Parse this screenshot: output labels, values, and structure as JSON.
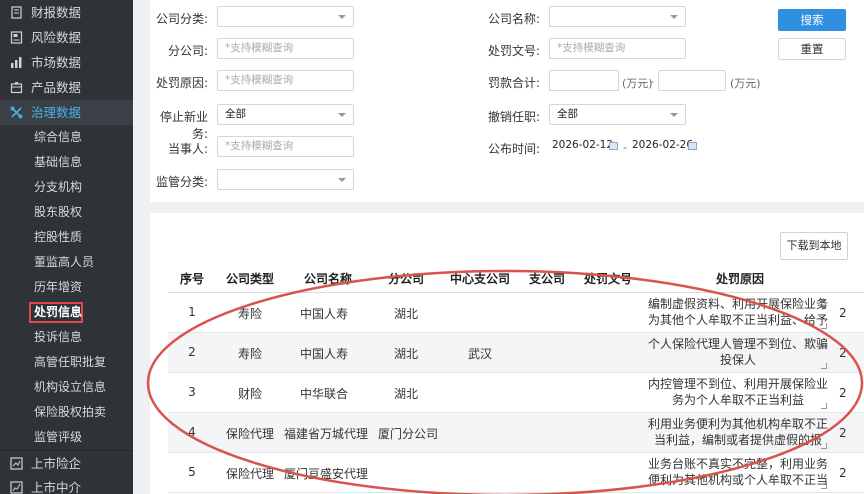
{
  "sidebar": {
    "top_items": [
      {
        "label": "财报数据",
        "icon": "file-icon"
      },
      {
        "label": "风险数据",
        "icon": "document-icon"
      },
      {
        "label": "市场数据",
        "icon": "bar-chart-icon"
      },
      {
        "label": "产品数据",
        "icon": "box-icon"
      }
    ],
    "active_item": {
      "label": "治理数据",
      "icon": "governance-icon"
    },
    "sub_items": [
      "综合信息",
      "基础信息",
      "分支机构",
      "股东股权",
      "控股性质",
      "董监高人员",
      "历年增资",
      "处罚信息",
      "投诉信息",
      "高管任职批复",
      "机构设立信息",
      "保险股权拍卖",
      "监管评级"
    ],
    "current_sub_index": 7,
    "bottom_items": [
      {
        "label": "上市险企",
        "icon": "chart-icon"
      },
      {
        "label": "上市中介",
        "icon": "trend-icon"
      }
    ]
  },
  "filters": {
    "company_category_label": "公司分类:",
    "company_name_label": "公司名称:",
    "branch_label": "分公司:",
    "branch_placeholder": "*支持模糊查询",
    "penalty_doc_label": "处罚文号:",
    "penalty_doc_placeholder": "*支持模糊查询",
    "penalty_reason_label": "处罚原因:",
    "penalty_reason_placeholder": "*支持模糊查询",
    "fine_total_label": "罚款合计:",
    "fine_unit": "(万元)",
    "fine_sep": "-",
    "stop_business_label": "停止新业务:",
    "stop_business_value": "全部",
    "revoke_label": "撤销任职:",
    "revoke_value": "全部",
    "party_label": "当事人:",
    "party_placeholder": "*支持模糊查询",
    "publish_time_label": "公布时间:",
    "date_from": "2026-02-12",
    "date_sep": "-",
    "date_to": "2026-02-26",
    "supervision_label": "监管分类:",
    "search_button": "搜索",
    "reset_button": "重置"
  },
  "download_button": "下载到本地",
  "table": {
    "headers": [
      "序号",
      "公司类型",
      "公司名称",
      "分公司",
      "中心支公司",
      "支公司",
      "处罚文号",
      "处罚原因"
    ],
    "rows": [
      {
        "no": "1",
        "type": "寿险",
        "name": "中国人寿",
        "branch": "湖北",
        "center": "",
        "sub": "",
        "doc": "",
        "reason": "编制虚假资料、利用开展保险业务为其他个人牟取不正当利益、给予",
        "trunc": "2"
      },
      {
        "no": "2",
        "type": "寿险",
        "name": "中国人寿",
        "branch": "湖北",
        "center": "武汉",
        "sub": "",
        "doc": "",
        "reason": "个人保险代理人管理不到位、欺骗投保人",
        "trunc": "2"
      },
      {
        "no": "3",
        "type": "财险",
        "name": "中华联合",
        "branch": "湖北",
        "center": "",
        "sub": "",
        "doc": "",
        "reason": "内控管理不到位、利用开展保险业务为个人牟取不正当利益",
        "trunc": "2"
      },
      {
        "no": "4",
        "type": "保险代理",
        "name": "福建省万城代理",
        "branch": "厦门分公司",
        "center": "",
        "sub": "",
        "doc": "",
        "reason": "利用业务便利为其他机构牟取不正当利益，编制或者提供虚假的报",
        "trunc": "2"
      },
      {
        "no": "5",
        "type": "保险代理",
        "name": "厦门亘盛安代理",
        "branch": "",
        "center": "",
        "sub": "",
        "doc": "",
        "reason": "业务台账不真实不完整，利用业务便利为其他机构或个人牟取不正当利益",
        "trunc": "2"
      }
    ]
  },
  "colors": {
    "sidebar_bg": "#2f3237",
    "accent_blue": "#2f8fe0",
    "highlight_red": "#e0484a",
    "oval_red": "#d9534f"
  }
}
